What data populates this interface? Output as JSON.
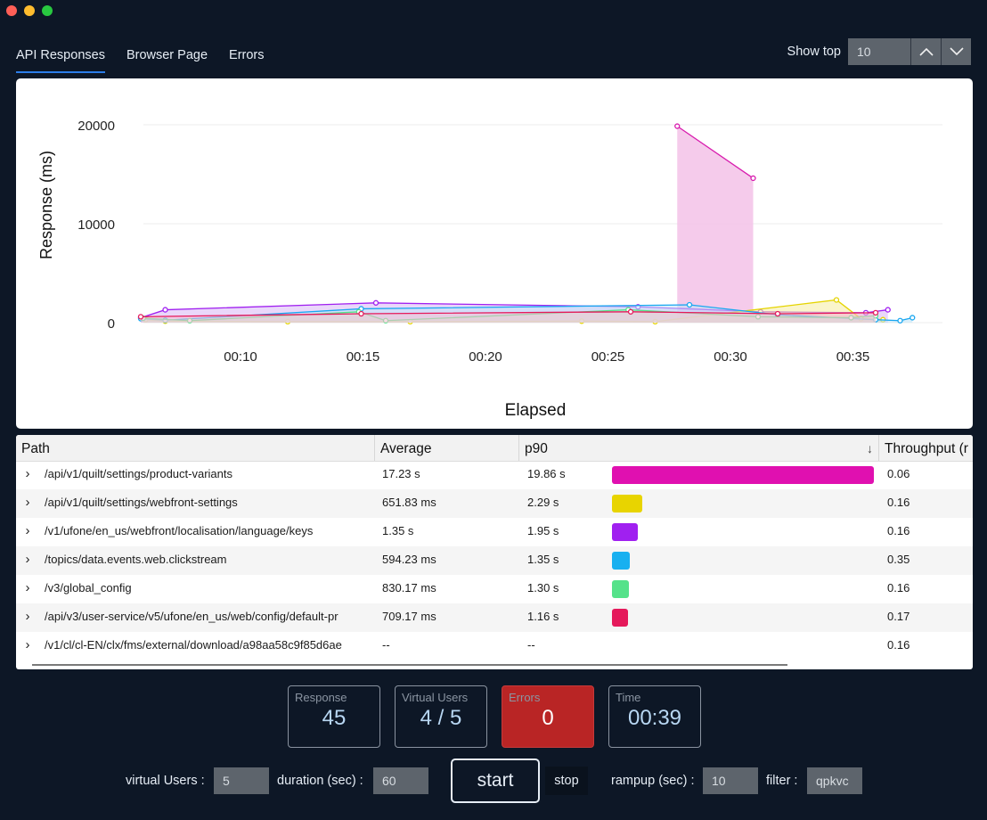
{
  "tabs": [
    "API Responses",
    "Browser Page",
    "Errors"
  ],
  "show_top": {
    "label": "Show top",
    "value": "10"
  },
  "chart_data": {
    "type": "area",
    "xlabel": "Elapsed",
    "ylabel": "Response (ms)",
    "y_ticks": [
      "20000",
      "10000",
      "0"
    ],
    "x_ticks": [
      "00:10",
      "00:15",
      "00:20",
      "00:25",
      "00:30",
      "00:35"
    ],
    "ylim": [
      0,
      20000
    ],
    "xlim": [
      6,
      38
    ],
    "series": [
      {
        "color": "#d81cae",
        "fill": "#f3c2e8",
        "points": [
          [
            27.9,
            19860
          ],
          [
            31.0,
            14600
          ]
        ]
      },
      {
        "color": "#a020f0",
        "fill": "#d8b6f5",
        "points": [
          [
            6.0,
            500
          ],
          [
            7.0,
            1300
          ],
          [
            15.6,
            2000
          ],
          [
            26.3,
            1600
          ],
          [
            31.3,
            1100
          ],
          [
            35.6,
            1000
          ],
          [
            36.5,
            1300
          ]
        ]
      },
      {
        "color": "#e5d400",
        "fill": "#f5eda0",
        "points": [
          [
            6.2,
            300
          ],
          [
            7.0,
            150
          ],
          [
            12.0,
            100
          ],
          [
            17.0,
            100
          ],
          [
            24.0,
            150
          ],
          [
            27.0,
            100
          ],
          [
            34.4,
            2300
          ],
          [
            35.4,
            400
          ],
          [
            36.3,
            300
          ]
        ]
      },
      {
        "color": "#1aa7f0",
        "fill": "#bfe4f8",
        "points": [
          [
            6.0,
            400
          ],
          [
            7.0,
            250
          ],
          [
            15.0,
            1400
          ],
          [
            28.4,
            1800
          ],
          [
            32.0,
            800
          ],
          [
            36.0,
            300
          ],
          [
            37.0,
            200
          ],
          [
            37.5,
            500
          ]
        ]
      },
      {
        "color": "#55e28a",
        "fill": "#c9f3da",
        "points": [
          [
            6.1,
            450
          ],
          [
            8.0,
            200
          ],
          [
            14.9,
            1100
          ],
          [
            16.0,
            200
          ],
          [
            25.9,
            1300
          ],
          [
            31.2,
            600
          ],
          [
            35.0,
            500
          ],
          [
            36.0,
            700
          ]
        ]
      },
      {
        "color": "#e5195b",
        "fill": "#f6bfd1",
        "points": [
          [
            6.0,
            600
          ],
          [
            15.0,
            900
          ],
          [
            26.0,
            1100
          ],
          [
            32.0,
            900
          ],
          [
            36.0,
            1000
          ]
        ]
      }
    ]
  },
  "table": {
    "columns": [
      "Path",
      "Average",
      "p90",
      "Throughput (r"
    ],
    "p90_max": 19.86,
    "rows": [
      {
        "path": "/api/v1/quilt/settings/product-variants",
        "average": "17.23 s",
        "p90": "19.86 s",
        "p90_value": 19.86,
        "color": "#e010b0",
        "throughput": "0.06"
      },
      {
        "path": "/api/v1/quilt/settings/webfront-settings",
        "average": "651.83 ms",
        "p90": "2.29 s",
        "p90_value": 2.29,
        "color": "#e8d400",
        "throughput": "0.16"
      },
      {
        "path": "/v1/ufone/en_us/webfront/localisation/language/keys",
        "average": "1.35 s",
        "p90": "1.95 s",
        "p90_value": 1.95,
        "color": "#a020f0",
        "throughput": "0.16"
      },
      {
        "path": "/topics/data.events.web.clickstream",
        "average": "594.23 ms",
        "p90": "1.35 s",
        "p90_value": 1.35,
        "color": "#18b0f0",
        "throughput": "0.35"
      },
      {
        "path": "/v3/global_config",
        "average": "830.17 ms",
        "p90": "1.30 s",
        "p90_value": 1.3,
        "color": "#55e28a",
        "throughput": "0.16"
      },
      {
        "path": "/api/v3/user-service/v5/ufone/en_us/web/config/default-pr",
        "average": "709.17 ms",
        "p90": "1.16 s",
        "p90_value": 1.16,
        "color": "#e5195b",
        "throughput": "0.17"
      },
      {
        "path": "/v1/cl/cl-EN/clx/fms/external/download/a98aa58c9f85d6ae",
        "average": "--",
        "p90": "--",
        "p90_value": 0,
        "color": "",
        "throughput": "0.16"
      }
    ]
  },
  "stats": [
    {
      "label": "Response",
      "value": "45"
    },
    {
      "label": "Virtual Users",
      "value": "4 / 5"
    },
    {
      "label": "Errors",
      "value": "0"
    },
    {
      "label": "Time",
      "value": "00:39"
    }
  ],
  "controls": {
    "virtual_users_label": "virtual Users :",
    "virtual_users_value": "5",
    "duration_label": "duration (sec) :",
    "duration_value": "60",
    "start_label": "start",
    "stop_label": "stop",
    "rampup_label": "rampup (sec) :",
    "rampup_value": "10",
    "filter_label": "filter :",
    "filter_value": "qpkvc"
  }
}
